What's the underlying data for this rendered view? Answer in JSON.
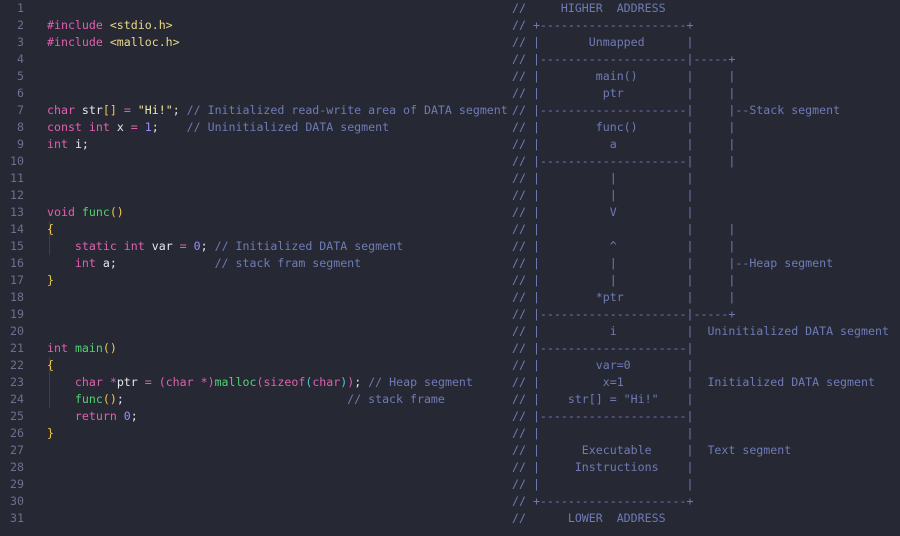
{
  "editor": {
    "theme_colors": {
      "background": "#262833",
      "line_number": "#6b7191",
      "keyword": "#e060b0",
      "function": "#52d273",
      "string": "#f1e7a8",
      "number": "#9b8cff",
      "bracket": "#f0c94a",
      "comment": "#6f7bb6",
      "text": "#e6e7ed"
    },
    "line_numbers": [
      "1",
      "2",
      "3",
      "4",
      "5",
      "6",
      "7",
      "8",
      "9",
      "10",
      "11",
      "12",
      "13",
      "14",
      "15",
      "16",
      "17",
      "18",
      "19",
      "20",
      "21",
      "22",
      "23",
      "24",
      "25",
      "26",
      "27",
      "28",
      "29",
      "30",
      "31"
    ],
    "code": {
      "l1": {
        "pp": "#include",
        "inc": "<stdio.h>"
      },
      "l2": {
        "pp": "#include",
        "inc": "<malloc.h>"
      },
      "l6": {
        "type": "char",
        "name": "str",
        "open": "[",
        "close": "]",
        "eq": "=",
        "str": "\"Hi!\"",
        "semi": ";",
        "comment": "// Initialized read-write area of DATA segment"
      },
      "l7": {
        "kw": "const",
        "type": "int",
        "name": "x",
        "eq": "=",
        "num": "1",
        "semi": ";",
        "comment": "// Uninitialized DATA segment"
      },
      "l8": {
        "type": "int",
        "name": "i",
        "semi": ";"
      },
      "l12": {
        "type": "void",
        "fn": "func",
        "parens": "()"
      },
      "l13": {
        "brace": "{"
      },
      "l14": {
        "kw": "static",
        "type": "int",
        "name": "var",
        "eq": "=",
        "num": "0",
        "semi": ";",
        "comment": "// Initialized DATA segment"
      },
      "l15": {
        "type": "int",
        "name": "a",
        "semi": ";",
        "comment": "// stack fram segment"
      },
      "l16": {
        "brace": "}"
      },
      "l20": {
        "type": "int",
        "fn": "main",
        "parens": "()"
      },
      "l21": {
        "brace": "{"
      },
      "l22": {
        "type": "char",
        "star": "*",
        "name": "ptr",
        "eq": "=",
        "cast_open": "(",
        "cast_type": "char",
        "cast_star": "*",
        "cast_close": ")",
        "fn": "malloc",
        "p1": "(",
        "fn2": "sizeof",
        "p2": "(",
        "arg": "char",
        "p2c": ")",
        "p1c": ")",
        "semi": ";",
        "comment": "// Heap segment"
      },
      "l23": {
        "fn": "func",
        "parens": "()",
        "semi": ";",
        "comment": "// stack frame"
      },
      "l24": {
        "kw": "return",
        "num": "0",
        "semi": ";"
      },
      "l25": {
        "brace": "}"
      }
    },
    "diagram_lines": [
      "//     HIGHER  ADDRESS",
      "// +---------------------+",
      "// |       Unmapped      |",
      "// |---------------------|-----+",
      "// |        main()       |     |",
      "// |         ptr         |     |",
      "// |---------------------|     |--Stack segment",
      "// |        func()       |     |",
      "// |          a          |     |",
      "// |---------------------|     |",
      "// |          |          |",
      "// |          |          |",
      "// |          V          |",
      "// |                     |     |",
      "// |          ^          |     |",
      "// |          |          |     |--Heap segment",
      "// |          |          |     |",
      "// |        *ptr         |     |",
      "// |---------------------|-----+",
      "// |          i          |  Uninitialized DATA segment",
      "// |---------------------|",
      "// |        var=0        |",
      "// |         x=1         |  Initialized DATA segment",
      "// |    str[] = \"Hi!\"    |",
      "// |---------------------|",
      "// |                     |",
      "// |      Executable     |  Text segment",
      "// |     Instructions    |",
      "// |                     |",
      "// +---------------------+",
      "//      LOWER  ADDRESS"
    ]
  }
}
